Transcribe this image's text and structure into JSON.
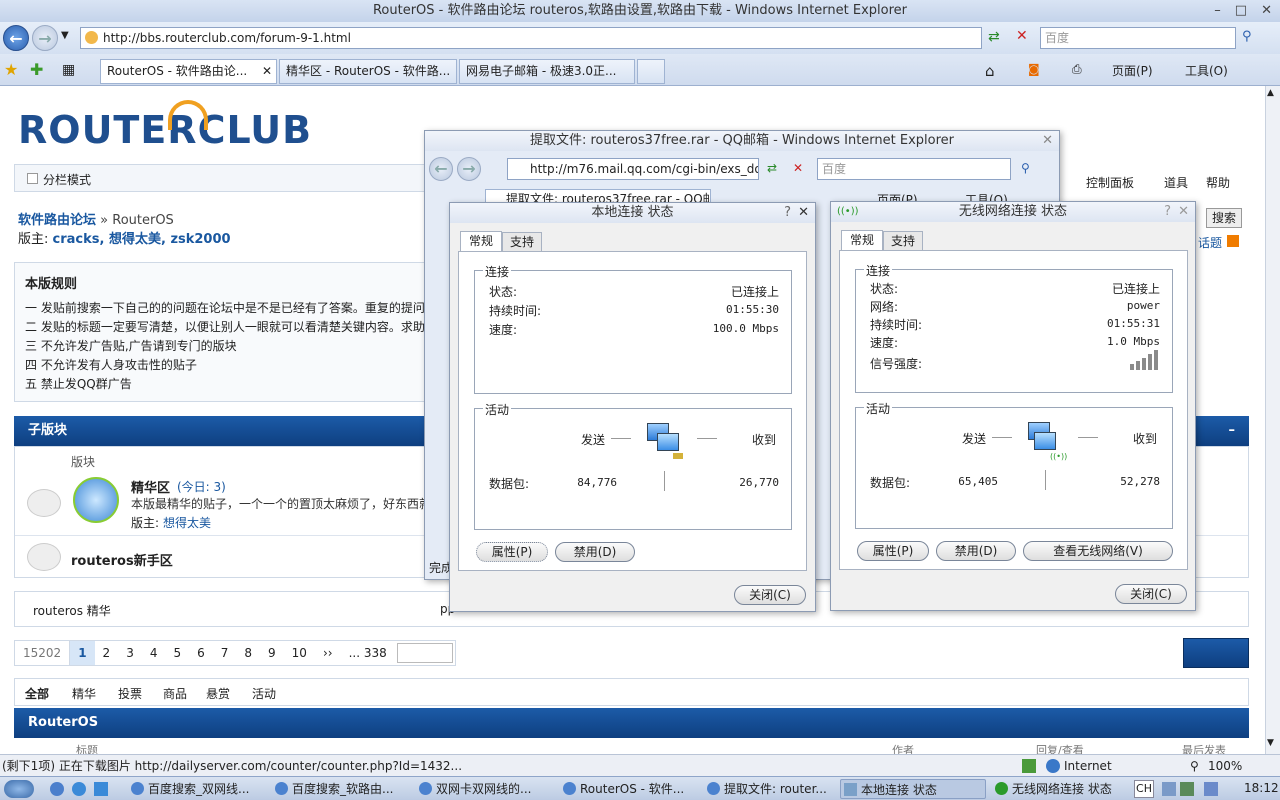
{
  "window_title": "RouterOS - 软件路由论坛 routeros,软路由设置,软路由下载 - Windows Internet Explorer",
  "address": "http://bbs.routerclub.com/forum-9-1.html",
  "search_placeholder": "百度",
  "tabs": [
    {
      "label": "RouterOS - 软件路由论..."
    },
    {
      "label": "精华区 - RouterOS - 软件路..."
    },
    {
      "label": "网易电子邮箱 - 极速3.0正..."
    }
  ],
  "toolbar": {
    "page": "页面(P)",
    "tools": "工具(O)"
  },
  "forum": {
    "logo": "ROUTERCLUB",
    "logo_router": "ROUTER",
    "logo_club": "CLUB",
    "split_mode": "分栏模式",
    "nav": {
      "control_panel": "控制面板",
      "tools": "道具",
      "help": "帮助",
      "search": "搜索",
      "topic": "话题"
    },
    "breadcrumb_home": "软件路由论坛",
    "breadcrumb_current": "» RouterOS",
    "moderators_label": "版主:",
    "moderators": "cracks, 想得太美, zsk2000",
    "rules_title": "本版规则",
    "rules": [
      "一 发贴前搜索一下自己的的问题在论坛中是不是已经有了答案。重复的提问",
      "二 发贴的标题一定要写清楚，以便让别人一眼就可以看清楚关键内容。求助",
      "三 不允许发广告贴,广告请到专门的版块",
      "四 不允许发有人身攻击性的贴子",
      "五 禁止发QQ群广告"
    ],
    "subforum_header": "子版块",
    "col_forum": "版块",
    "sub1_name": "精华区",
    "sub1_today": "(今日: 3)",
    "sub1_desc": "本版最精华的贴子，一个一个的置顶太麻烦了，好东西就",
    "sub1_mod_label": "版主:",
    "sub1_mod": "想得太美",
    "sub2_name": "routeros新手区",
    "tags_left": "routeros 精华",
    "tags_mid": "pp",
    "pager": {
      "total": "15202",
      "pages": [
        "1",
        "2",
        "3",
        "4",
        "5",
        "6",
        "7",
        "8",
        "9",
        "10",
        "››",
        "... 338"
      ]
    },
    "filters": [
      "全部",
      "精华",
      "投票",
      "商品",
      "悬赏",
      "活动"
    ],
    "thread_header": "RouterOS",
    "col_title": "标题",
    "col_author": "作者",
    "col_replies": "回复/查看",
    "col_last": "最后发表"
  },
  "mail_window": {
    "title": "提取文件: routeros37free.rar - QQ邮箱 - Windows Internet Explorer",
    "address": "http://m76.mail.qq.com/cgi-bin/exs_downloa",
    "search": "百度",
    "tab": "提取文件: routeros37free.rar - QQ邮箱",
    "page": "页面(P)",
    "tools": "工具(O)",
    "status": "完成"
  },
  "lan_dialog": {
    "title": "本地连接 状态",
    "tab_general": "常规",
    "tab_support": "支持",
    "connection": "连接",
    "status_label": "状态:",
    "status_value": "已连接上",
    "duration_label": "持续时间:",
    "duration_value": "01:55:30",
    "speed_label": "速度:",
    "speed_value": "100.0 Mbps",
    "activity": "活动",
    "sent": "发送",
    "received": "收到",
    "packets_label": "数据包:",
    "packets_sent": "84,776",
    "packets_received": "26,770",
    "properties": "属性(P)",
    "disable": "禁用(D)",
    "close": "关闭(C)"
  },
  "wifi_dialog": {
    "title": "无线网络连接 状态",
    "tab_general": "常规",
    "tab_support": "支持",
    "connection": "连接",
    "status_label": "状态:",
    "status_value": "已连接上",
    "network_label": "网络:",
    "network_value": "power",
    "duration_label": "持续时间:",
    "duration_value": "01:55:31",
    "speed_label": "速度:",
    "speed_value": "1.0 Mbps",
    "signal_label": "信号强度:",
    "activity": "活动",
    "sent": "发送",
    "received": "收到",
    "packets_label": "数据包:",
    "packets_sent": "65,405",
    "packets_received": "52,278",
    "properties": "属性(P)",
    "disable": "禁用(D)",
    "view_wireless": "查看无线网络(V)",
    "close": "关闭(C)"
  },
  "status_bar": {
    "text": "(剩下1项) 正在下载图片 http://dailyserver.com/counter/counter.php?Id=1432...",
    "zone": "Internet",
    "zoom": "100%"
  },
  "taskbar": {
    "items": [
      "百度搜索_双网线...",
      "百度搜索_软路由...",
      "双网卡双网线的...",
      "RouterOS - 软件...",
      "提取文件: router...",
      "本地连接 状态",
      "无线网络连接 状态"
    ],
    "lang": "CH",
    "clock": "18:12"
  }
}
